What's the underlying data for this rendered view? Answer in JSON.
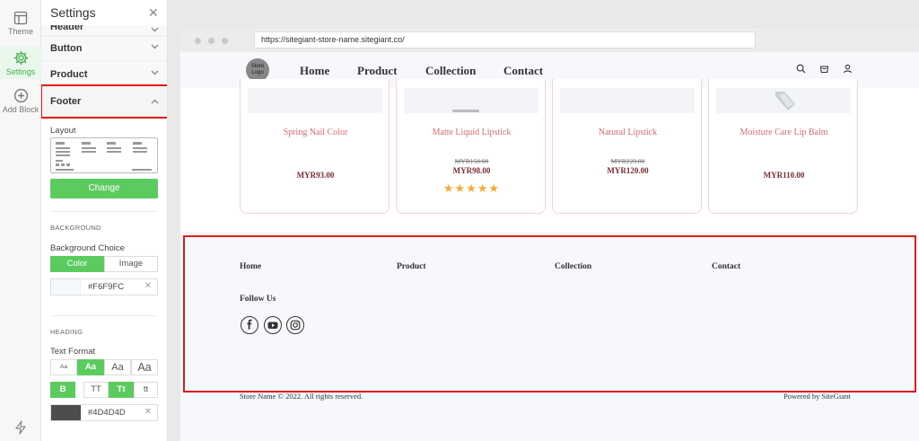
{
  "rail": {
    "items": [
      {
        "label": "Theme",
        "icon": "layout-icon"
      },
      {
        "label": "Settings",
        "icon": "gear-icon"
      },
      {
        "label": "Add Block",
        "icon": "plus-circle-icon"
      }
    ]
  },
  "settings": {
    "title": "Settings",
    "sections": {
      "header": "Header",
      "button": "Button",
      "product": "Product",
      "footer": "Footer"
    },
    "layout_label": "Layout",
    "change_label": "Change",
    "background_heading": "BACKGROUND",
    "background_choice_label": "Background Choice",
    "background_options": [
      "Color",
      "Image"
    ],
    "background_selected": "Color",
    "background_color": "#F6F9FC",
    "heading_heading": "HEADING",
    "text_format_label": "Text Format",
    "text_sizes": [
      "Aa",
      "Aa",
      "Aa",
      "Aa"
    ],
    "text_size_selected": 1,
    "bold_label": "B",
    "case_options": [
      "TT",
      "Tt",
      "tt"
    ],
    "case_selected": 1,
    "heading_color": "#4D4D4D",
    "accent_color": "#5CCB5F",
    "highlight_color": "#E01B1B"
  },
  "browser": {
    "url": "https://sitegiant-store-name.sitegiant.co/"
  },
  "site": {
    "logo_text": "Store Logo",
    "nav": [
      "Home",
      "Product",
      "Collection",
      "Contact"
    ],
    "products": [
      {
        "name": "Spring Nail Color",
        "old_price": "",
        "price": "MYR93.00",
        "rating": 0
      },
      {
        "name": "Matte Liquid Lipstick",
        "old_price": "MYR150.00",
        "price": "MYR98.00",
        "rating": 5
      },
      {
        "name": "Natural Lipstick",
        "old_price": "MYR220.00",
        "price": "MYR120.00",
        "rating": 0
      },
      {
        "name": "Moisture Care Lip Balm",
        "old_price": "",
        "price": "MYR110.00",
        "rating": 0
      }
    ],
    "stars": "★★★★★",
    "footer": {
      "links": [
        "Home",
        "Product",
        "Collection",
        "Contact"
      ],
      "follow_label": "Follow Us",
      "social": [
        "facebook-icon",
        "youtube-icon",
        "instagram-icon"
      ],
      "copyright": "Store Name © 2022. All rights reserved.",
      "powered_by": "Powered by  SiteGiant"
    }
  }
}
